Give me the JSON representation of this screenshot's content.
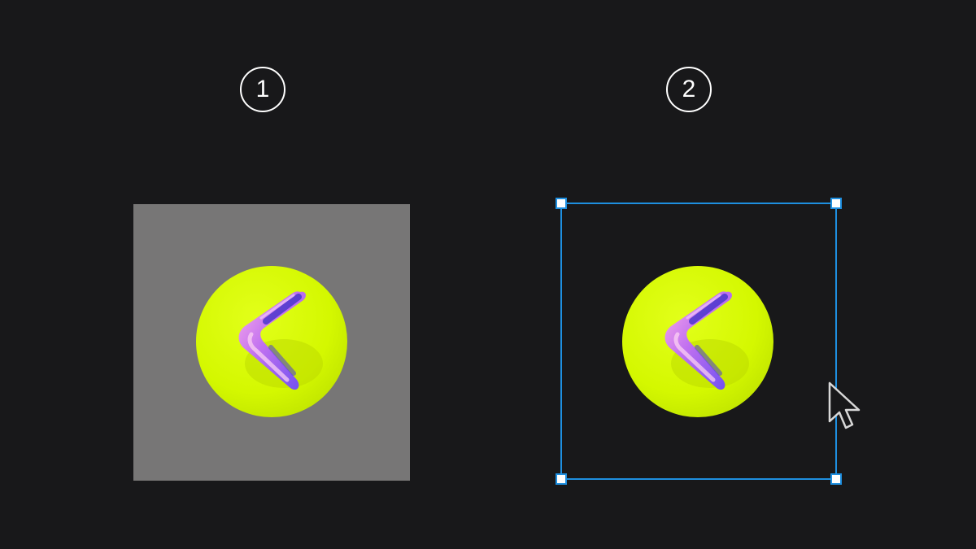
{
  "steps": {
    "first": "1",
    "second": "2"
  },
  "colors": {
    "background": "#18181a",
    "gray_panel": "#777676",
    "selection_blue": "#1e8fe0",
    "disc_yellow": "#d4f800",
    "balloon_pink": "#f08ad8",
    "balloon_violet": "#8a5cf0"
  },
  "icons": {
    "artwork": "chevron-left-balloon-icon",
    "cursor": "mouse-pointer-icon"
  }
}
